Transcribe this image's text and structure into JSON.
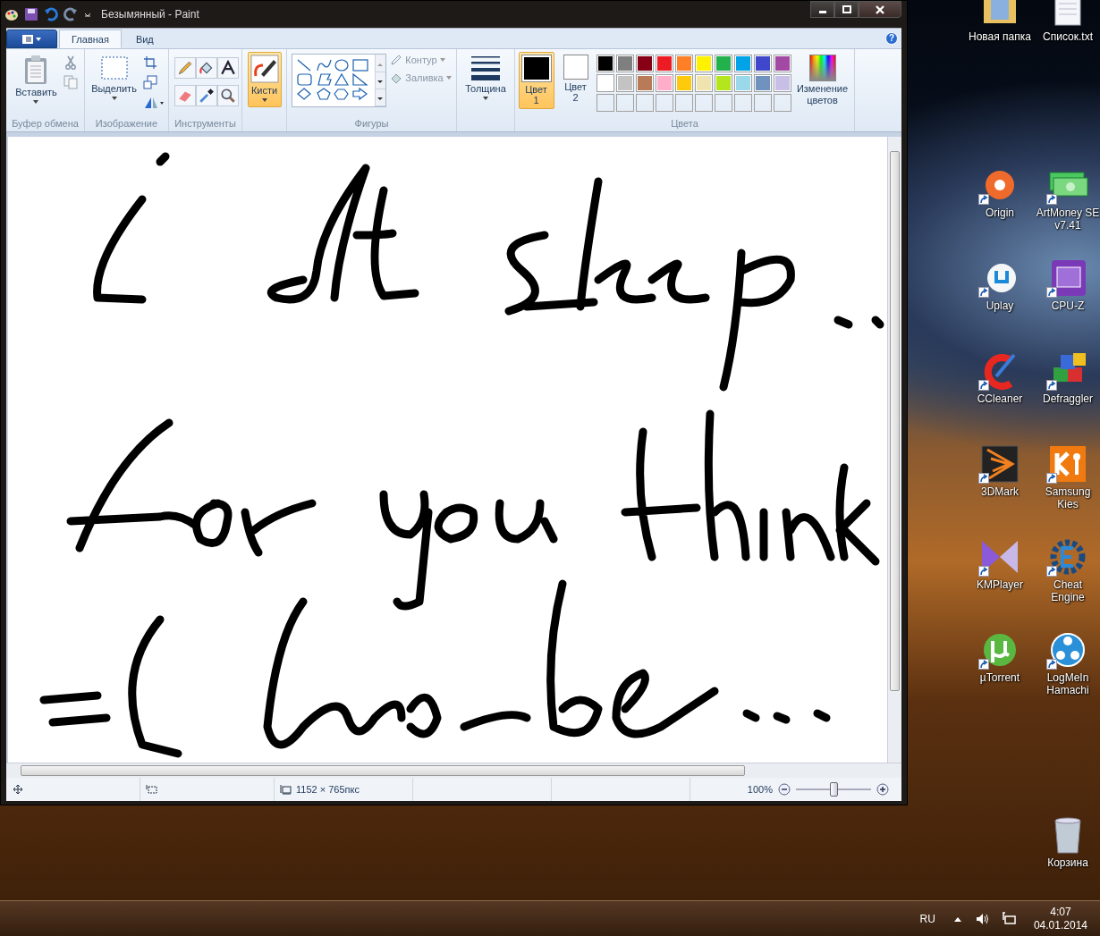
{
  "window": {
    "title": "Безымянный - Paint"
  },
  "ribbon": {
    "tabs": [
      {
        "label": "Главная",
        "selected": true
      },
      {
        "label": "Вид",
        "selected": false
      }
    ],
    "help": "?",
    "clipboard": {
      "label": "Буфер обмена",
      "paste": "Вставить"
    },
    "image": {
      "label": "Изображение",
      "select": "Выделить"
    },
    "tools": {
      "label": "Инструменты"
    },
    "brushes": {
      "label": "Кисти",
      "selected": true
    },
    "shapes": {
      "label": "Фигуры",
      "outline": {
        "label": "Контур",
        "disabled": true
      },
      "fill": {
        "label": "Заливка",
        "disabled": true
      }
    },
    "size": {
      "label": "Толщина"
    },
    "colors": {
      "label": "Цвета",
      "slots": [
        {
          "label": "Цвет",
          "number": "1",
          "selected": true,
          "color": "#000000"
        },
        {
          "label": "Цвет",
          "number": "2",
          "selected": false,
          "color": "#ffffff"
        }
      ],
      "palette": [
        {
          "color": "#000000"
        },
        {
          "color": "#7f7f7f"
        },
        {
          "color": "#880015"
        },
        {
          "color": "#ed1c24"
        },
        {
          "color": "#ff7f27"
        },
        {
          "color": "#fff200"
        },
        {
          "color": "#22b14c"
        },
        {
          "color": "#00a2e8"
        },
        {
          "color": "#3f48cc"
        },
        {
          "color": "#a349a4"
        },
        {
          "color": "#ffffff"
        },
        {
          "color": "#c3c3c3"
        },
        {
          "color": "#b97a57"
        },
        {
          "color": "#ffaec9"
        },
        {
          "color": "#ffc90e"
        },
        {
          "color": "#efe4b0"
        },
        {
          "color": "#b5e61d"
        },
        {
          "color": "#99d9ea"
        },
        {
          "color": "#7092be"
        },
        {
          "color": "#c8bfe7"
        }
      ],
      "edit_colors": "Изменение цветов"
    }
  },
  "status_bar": {
    "dimensions": "1152 × 765пкс",
    "zoom": "100%",
    "zoom_slider": {
      "level": 0.5
    }
  },
  "desktop_icons": [
    {
      "label": "Новая папка",
      "shortcut": false
    },
    {
      "label": "Список.txt",
      "shortcut": false
    },
    {
      "label": "Origin",
      "shortcut": true
    },
    {
      "label": "ArtMoney SE v7.41",
      "shortcut": true
    },
    {
      "label": "Uplay",
      "shortcut": true
    },
    {
      "label": "CPU-Z",
      "shortcut": true
    },
    {
      "label": "CCleaner",
      "shortcut": true
    },
    {
      "label": "Defraggler",
      "shortcut": true
    },
    {
      "label": "3DMark",
      "shortcut": true
    },
    {
      "label": "Samsung Kies",
      "shortcut": true
    },
    {
      "label": "KMPlayer",
      "shortcut": true
    },
    {
      "label": "Cheat Engine",
      "shortcut": true
    },
    {
      "label": "µTorrent",
      "shortcut": true
    },
    {
      "label": "LogMeIn Hamachi",
      "shortcut": true
    }
  ],
  "recycle_bin": {
    "label": "Корзина"
  },
  "taskbar": {
    "language": "RU",
    "time": "4:07",
    "date": "04.01.2014"
  }
}
